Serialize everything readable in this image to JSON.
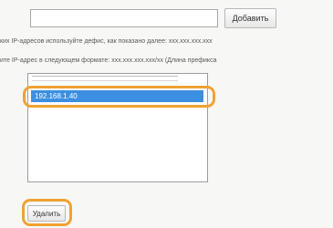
{
  "form": {
    "address_value": "",
    "add_label": "Добавить",
    "hint_range": "ких IP-адресов используйте дефис, как показано далее: xxx.xxx.xxx.xxx",
    "hint_format": "ите IP-адрес в следующем формате: xxx.xxx.xxx.xxx/xx (Длина префикса"
  },
  "address_list": {
    "items": [
      "192.168.1.40"
    ],
    "selected": "192.168.1.40"
  },
  "delete_label": "Удалить",
  "colors": {
    "highlight_ring": "#f0a233",
    "selection": "#3c8fe0"
  }
}
